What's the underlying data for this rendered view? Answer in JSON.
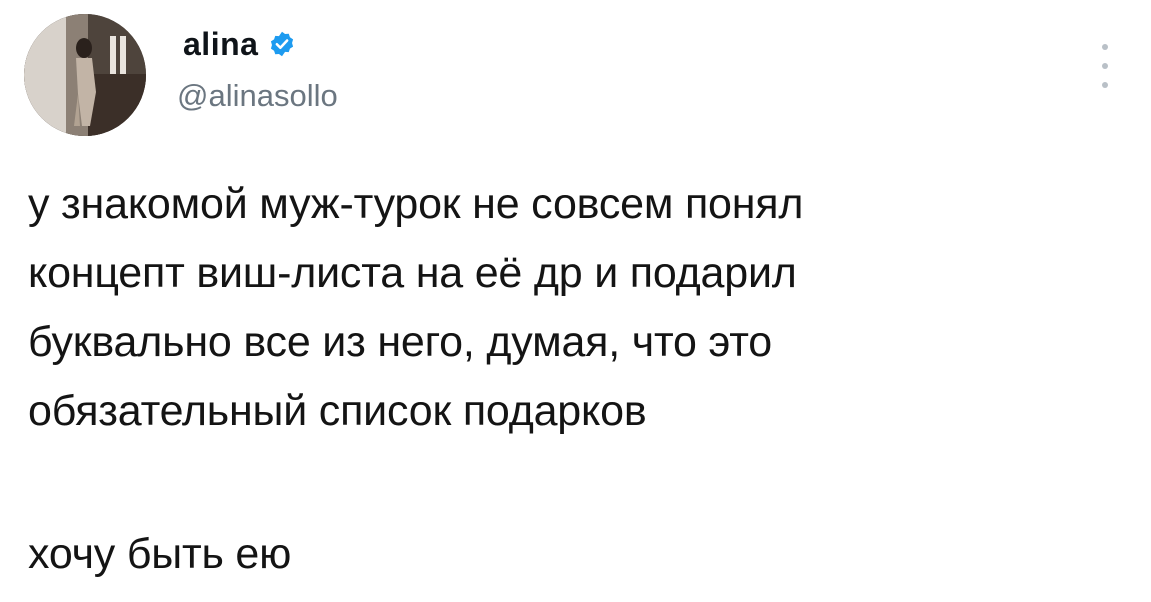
{
  "author": {
    "display_name": "alina",
    "handle": "@alinasollo",
    "verified": true,
    "avatar_icon": "profile-photo-avatar",
    "verified_icon": "verified-badge-icon",
    "verified_color": "#1d9bf0"
  },
  "tweet": {
    "lines": [
      "у знакомой муж-турок не совсем понял",
      "концепт виш-листа на её др и подарил",
      "буквально все из него, думая, что это",
      "обязательный список подарков"
    ],
    "final_line": "хочу быть ею"
  },
  "menu": {
    "icon": "more-vertical-icon"
  }
}
